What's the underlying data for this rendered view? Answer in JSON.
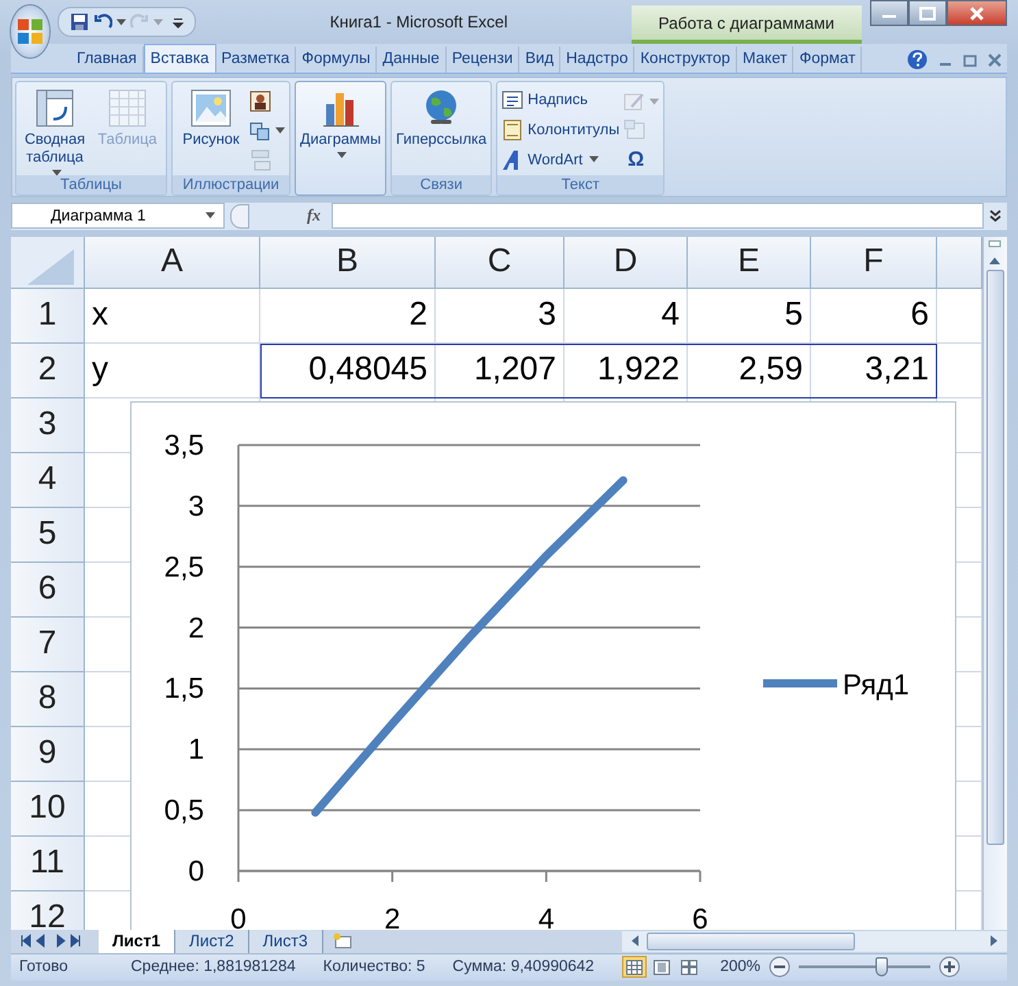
{
  "window": {
    "title": "Книга1 - Microsoft Excel",
    "context_title": "Работа с диаграммами"
  },
  "quick_access": [
    {
      "disabled": false,
      "dropdown": false
    },
    {
      "disabled": false,
      "dropdown": true
    },
    {
      "disabled": true,
      "dropdown": true
    }
  ],
  "ribbon_tabs": [
    {
      "label": "Главная",
      "selected": false
    },
    {
      "label": "Вставка",
      "selected": true
    },
    {
      "label": "Разметка",
      "selected": false
    },
    {
      "label": "Формулы",
      "selected": false
    },
    {
      "label": "Данные",
      "selected": false
    },
    {
      "label": "Рецензи",
      "selected": false
    },
    {
      "label": "Вид",
      "selected": false
    },
    {
      "label": "Надстро",
      "selected": false
    },
    {
      "label": "Конструктор",
      "selected": false
    },
    {
      "label": "Макет",
      "selected": false
    },
    {
      "label": "Формат",
      "selected": false
    }
  ],
  "ribbon_groups": [
    {
      "label": "Таблицы",
      "active": false,
      "items": [
        {
          "kind": "large",
          "label": "Сводная таблица",
          "disabled": false,
          "dropdown": true
        },
        {
          "kind": "large",
          "label": "Таблица",
          "disabled": true,
          "dropdown": false
        }
      ]
    },
    {
      "label": "Иллюстрации",
      "active": false,
      "items": [
        {
          "kind": "large",
          "label": "Рисунок",
          "disabled": false,
          "dropdown": false
        },
        {
          "kind": "icon",
          "disabled": false,
          "dropdown": false
        },
        {
          "kind": "icon",
          "disabled": false,
          "dropdown": true
        },
        {
          "kind": "icon",
          "disabled": true,
          "dropdown": false
        }
      ]
    },
    {
      "active": true,
      "items": [
        {
          "kind": "large",
          "label": "Диаграммы",
          "disabled": false,
          "dropdown": true
        }
      ]
    },
    {
      "label": "Связи",
      "active": false,
      "items": [
        {
          "kind": "large",
          "label": "Гиперссылка",
          "disabled": false,
          "dropdown": false
        }
      ]
    },
    {
      "label": "Текст",
      "active": false,
      "items": [
        {
          "kind": "small",
          "label": "Надпись",
          "disabled": false,
          "dropdown": false
        },
        {
          "kind": "small",
          "label": "Колонтитулы",
          "disabled": false,
          "dropdown": false
        },
        {
          "kind": "small",
          "label": "WordArt",
          "disabled": false,
          "dropdown": true
        },
        {
          "kind": "icon",
          "disabled": true,
          "dropdown": true
        },
        {
          "kind": "icon",
          "disabled": true,
          "dropdown": false
        },
        {
          "kind": "symbol",
          "label": "Ω",
          "disabled": false,
          "dropdown": false
        }
      ]
    }
  ],
  "formula_bar": {
    "name_box": "Диаграмма 1",
    "function_label": "fx"
  },
  "sheet": {
    "columns": [
      "A",
      "B",
      "C",
      "D",
      "E",
      "F"
    ],
    "rows": [
      {
        "header": "1",
        "selected": false,
        "cells": [
          "x",
          "2",
          "3",
          "4",
          "5",
          "6"
        ]
      },
      {
        "header": "2",
        "selected": true,
        "cells": [
          "y",
          "0,48045",
          "1,207",
          "1,922",
          "2,59",
          "3,21"
        ]
      },
      {
        "header": "3",
        "selected": false
      },
      {
        "header": "4",
        "selected": false
      },
      {
        "header": "5",
        "selected": false
      },
      {
        "header": "6",
        "selected": false
      },
      {
        "header": "7",
        "selected": false
      },
      {
        "header": "8",
        "selected": false
      },
      {
        "header": "9",
        "selected": false
      },
      {
        "header": "10",
        "selected": false
      },
      {
        "header": "11",
        "selected": false
      },
      {
        "header": "12",
        "selected": false
      }
    ]
  },
  "chart": {
    "chart_data": {
      "type": "line",
      "x": [
        1,
        2,
        3,
        4,
        5
      ],
      "series": [
        {
          "name": "Ряд1",
          "color": "#4f81bd",
          "values": [
            0.48,
            1.21,
            1.92,
            2.59,
            3.21
          ]
        }
      ],
      "grid": true,
      "xlim": [
        0,
        6
      ],
      "ylim": [
        0,
        3.5
      ],
      "xticks": [
        0,
        2,
        4,
        6
      ],
      "yticks": [
        {
          "value": 0,
          "label": "0"
        },
        {
          "value": 0.5,
          "label": "0,5"
        },
        {
          "value": 1,
          "label": "1"
        },
        {
          "value": 1.5,
          "label": "1,5"
        },
        {
          "value": 2,
          "label": "2"
        },
        {
          "value": 2.5,
          "label": "2,5"
        },
        {
          "value": 3,
          "label": "3"
        },
        {
          "value": 3.5,
          "label": "3,5"
        }
      ]
    }
  },
  "sheet_tabs": [
    {
      "label": "Лист1",
      "selected": true
    },
    {
      "label": "Лист2",
      "selected": false
    },
    {
      "label": "Лист3",
      "selected": false
    }
  ],
  "status_bar": {
    "ready": "Готово",
    "average": "Среднее: 1,881981284",
    "count": "Количество: 5",
    "sum": "Сумма: 9,40990642",
    "views": [
      {
        "selected": true
      },
      {
        "selected": false
      },
      {
        "selected": false
      }
    ],
    "zoom": "200%",
    "zoom_slider": {
      "level": 0.62
    }
  }
}
